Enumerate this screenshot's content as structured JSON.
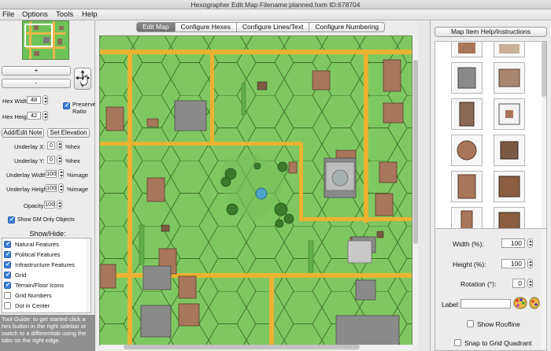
{
  "window": {
    "title": "Hexographer Edit Map Filename:planned.hxm ID:678704"
  },
  "menu": [
    "File",
    "Options",
    "Tools",
    "Help"
  ],
  "left": {
    "zoom_in": "+",
    "zoom_out": "-",
    "hex_width_label": "Hex Width:",
    "hex_width": "48",
    "hex_height_label": "Hex Height:",
    "hex_height": "42",
    "preserve_ratio": "Preserve Ratio",
    "add_edit_note": "Add/Edit Note",
    "set_elevation": "Set Elevation",
    "underlay_x_label": "Underlay X:",
    "underlay_x": "0",
    "underlay_y_label": "Underlay Y:",
    "underlay_y": "0",
    "hex_unit": "%hex",
    "underlay_width_label": "Underlay Width:",
    "underlay_width": "100",
    "underlay_height_label": "Underlay Height:",
    "underlay_height": "100",
    "image_unit": "%image",
    "opacity_label": "Opacity:",
    "opacity": "100",
    "show_gm": "Show GM Only Objects",
    "show_hide_title": "Show/Hide:",
    "show_hide_items": [
      {
        "label": "Natural Features",
        "checked": true
      },
      {
        "label": "Political Features",
        "checked": true
      },
      {
        "label": "Infrastructure Features",
        "checked": true
      },
      {
        "label": "Grid",
        "checked": true
      },
      {
        "label": "Terrain/Floor Icons",
        "checked": true
      },
      {
        "label": "Grid Numbers",
        "checked": false
      },
      {
        "label": "Dot in Center",
        "checked": false
      }
    ],
    "tool_guide": "Tool Guide: to get started click a hex button in the right sidebar or switch to a differenttab using the tabs on the right edge."
  },
  "tabs": [
    "Edit Map",
    "Configure Hexes",
    "Configure Lines/Text",
    "Configure Numbering"
  ],
  "active_tab": "Edit Map",
  "right": {
    "help_button": "Map Item Help/Instructions",
    "width_label": "Width (%):",
    "width": "100",
    "height_label": "Height (%):",
    "height": "100",
    "rotation_label": "Rotation (°):",
    "rotation": "0",
    "label_label": "Label:",
    "label_value": "",
    "show_roofline": "Show Roofline",
    "snap_label": "Snap to Grid Quadrant"
  },
  "colors": {
    "grass": "#7fc861",
    "road": "#f2b230",
    "hex_line": "#3f6e2a",
    "roof": "#a8765a",
    "accent_blue": "#3d7fd9"
  }
}
